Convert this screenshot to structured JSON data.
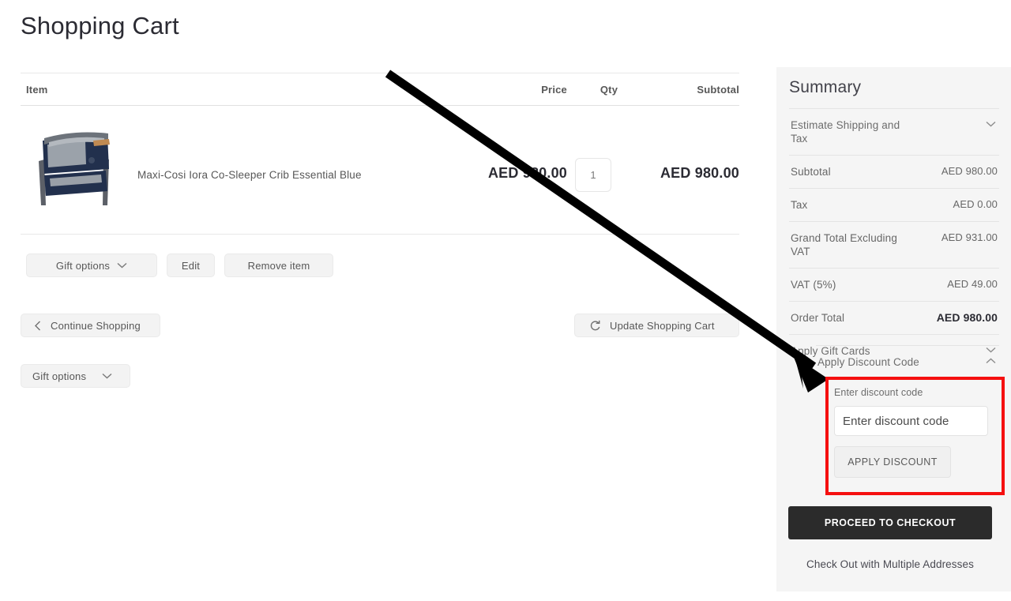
{
  "page": {
    "title": "Shopping Cart"
  },
  "cart_table": {
    "columns": {
      "item": "Item",
      "price": "Price",
      "qty": "Qty",
      "subtotal": "Subtotal"
    },
    "rows": [
      {
        "name": "Maxi-Cosi Iora Co-Sleeper Crib Essential Blue",
        "price": "AED 980.00",
        "qty": "1",
        "subtotal": "AED 980.00",
        "image_alt": "crib-product-image"
      }
    ],
    "row_actions": {
      "gift_options": "Gift options",
      "edit": "Edit",
      "remove_item": "Remove item"
    }
  },
  "main_actions": {
    "continue_shopping": "Continue Shopping",
    "update_cart": "Update Shopping Cart",
    "gift_options": "Gift options"
  },
  "summary": {
    "title": "Summary",
    "estimate_shipping": "Estimate Shipping and Tax",
    "lines": [
      {
        "label": "Subtotal",
        "value": "AED 980.00"
      },
      {
        "label": "Tax",
        "value": "AED 0.00"
      },
      {
        "label": "Grand Total Excluding VAT",
        "value": "AED 931.00"
      },
      {
        "label": "VAT (5%)",
        "value": "AED 49.00"
      },
      {
        "label": "Order Total",
        "value": "AED 980.00"
      }
    ],
    "apply_gift_cards": "Apply Gift Cards",
    "apply_discount_code": "Apply Discount Code",
    "discount": {
      "field_label": "Enter discount code",
      "input_value": "",
      "input_placeholder": "Enter discount code",
      "apply_button": "APPLY DISCOUNT"
    },
    "checkout_button": "PROCEED TO CHECKOUT",
    "multiple_addresses": "Check Out with Multiple Addresses"
  },
  "annotation": {
    "highlight_color": "#f50f0f",
    "arrow_color": "#000000"
  }
}
